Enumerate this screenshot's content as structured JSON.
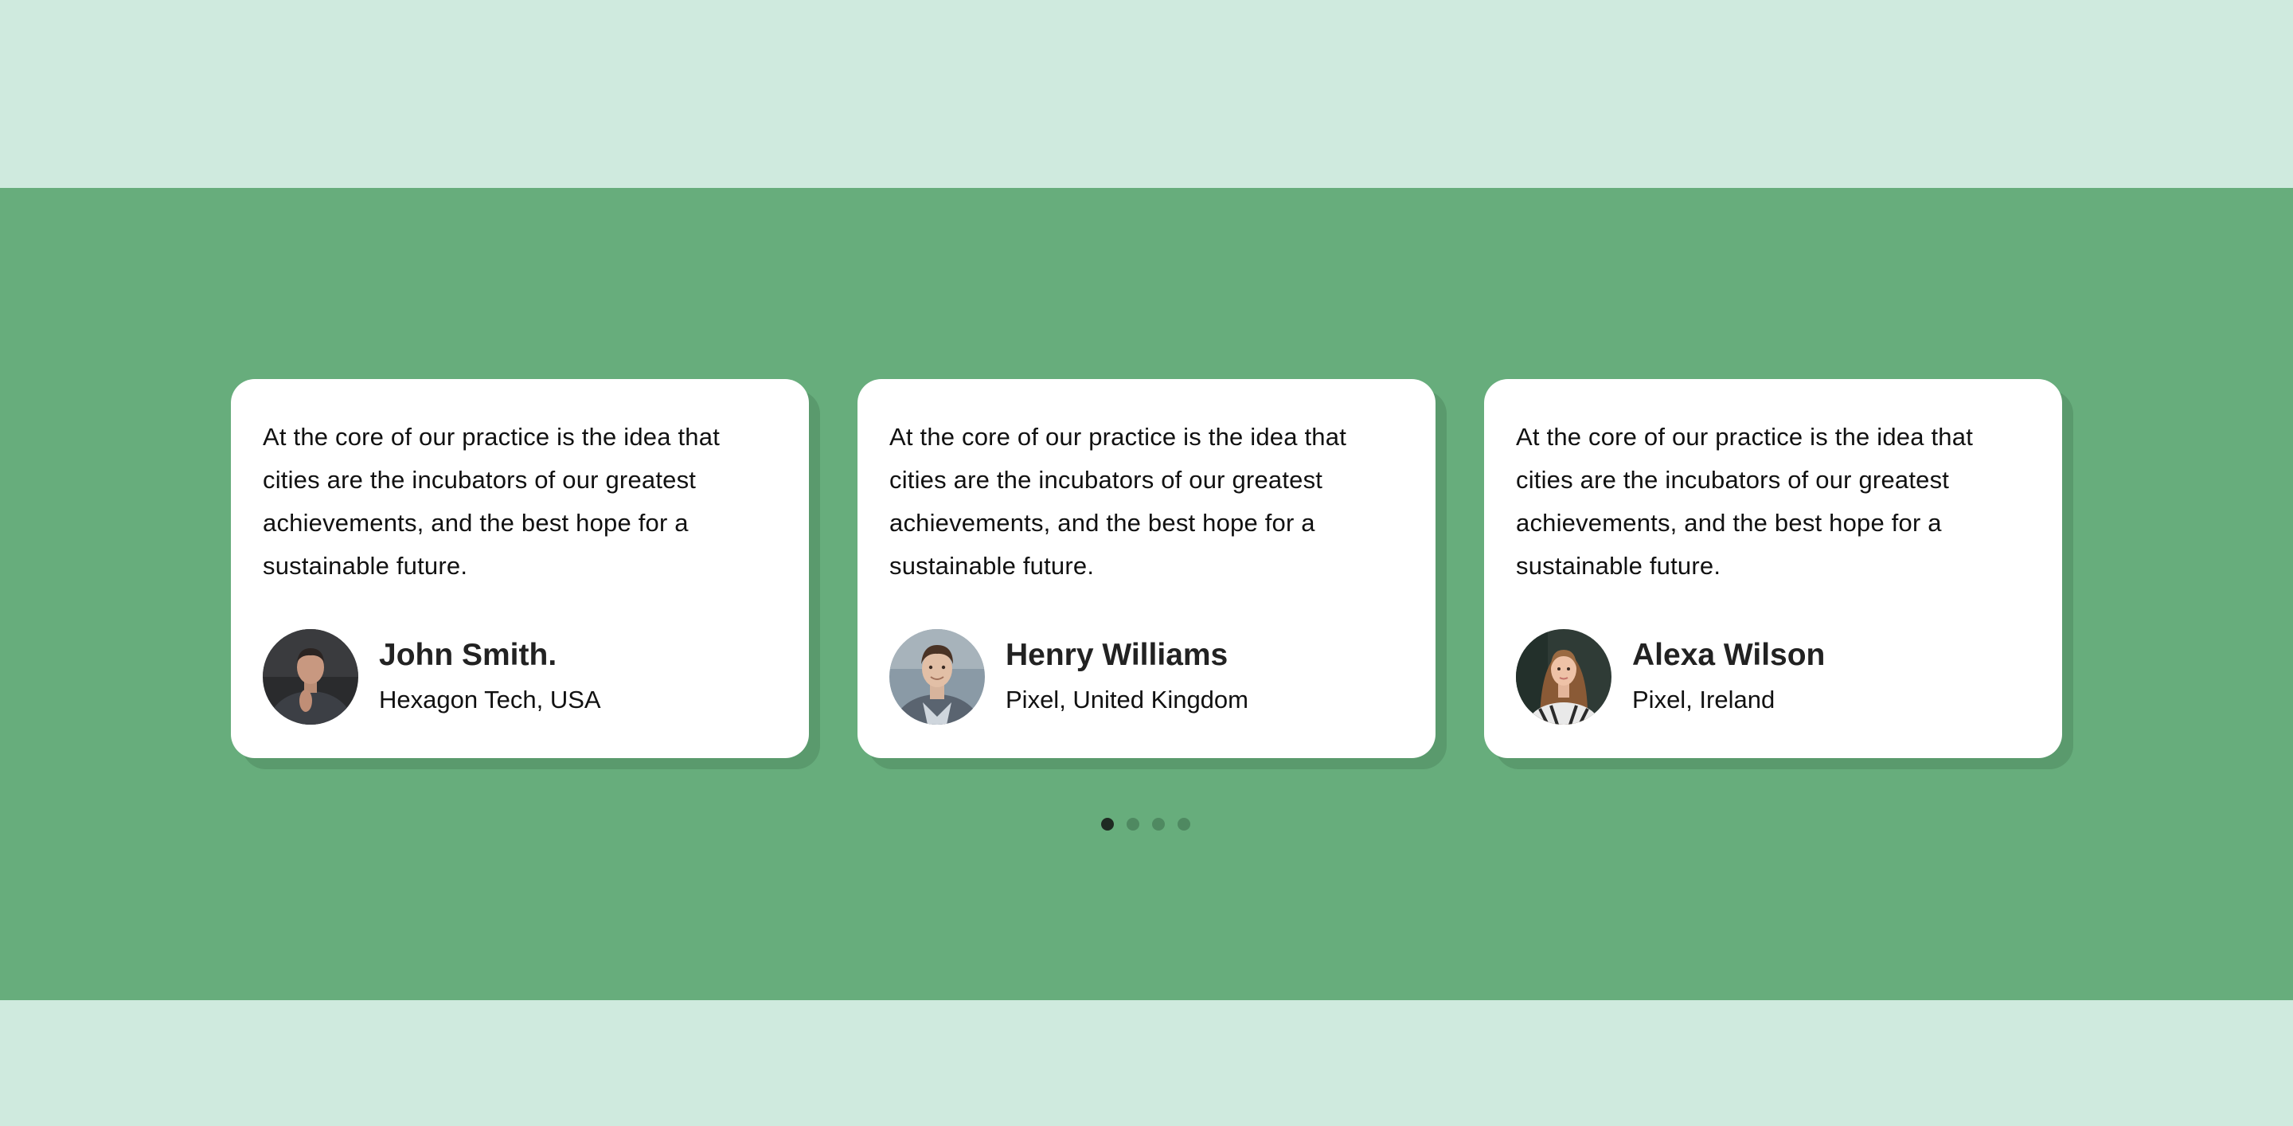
{
  "colors": {
    "page_bg": "#cfeade",
    "band_bg": "#67ad7c",
    "card_bg": "#ffffff",
    "card_shadow": "#5a9a6d",
    "dot_active": "#1f2a22",
    "dot_inactive": "#4f8961"
  },
  "testimonials": [
    {
      "quote": "At the core of our practice is the idea that cities are the incubators of our greatest achievements, and the best hope for a sustainable future.",
      "name": "John Smith.",
      "company": "Hexagon Tech, USA",
      "avatar": "man-portrait-dark"
    },
    {
      "quote": "At the core of our practice is the idea that cities are the incubators of our greatest achievements, and the best hope for a sustainable future.",
      "name": "Henry Williams",
      "company": "Pixel, United Kingdom",
      "avatar": "man-portrait-light"
    },
    {
      "quote": "At the core of our practice is the idea that cities are the incubators of our greatest achievements, and the best hope for a sustainable future.",
      "name": "Alexa Wilson",
      "company": "Pixel, Ireland",
      "avatar": "woman-portrait"
    }
  ],
  "pagination": {
    "count": 4,
    "active_index": 0
  }
}
